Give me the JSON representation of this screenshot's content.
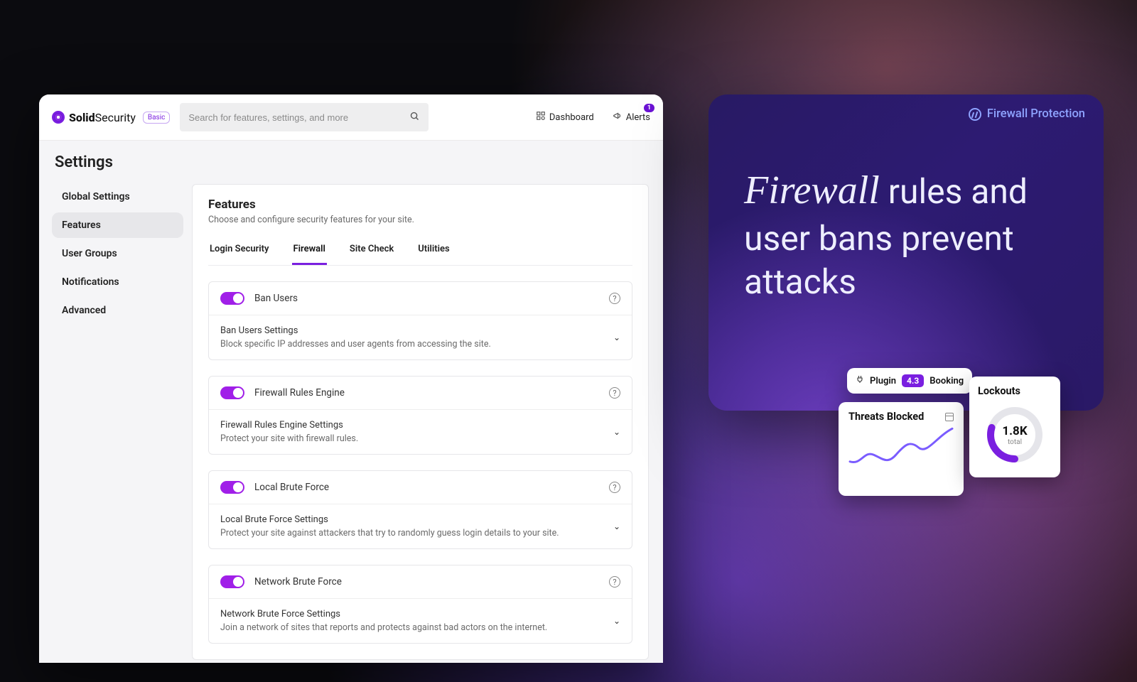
{
  "brand": {
    "bold": "Solid",
    "light": "Security",
    "badge": "Basic"
  },
  "search": {
    "placeholder": "Search for features, settings, and more"
  },
  "toplinks": {
    "dashboard": "Dashboard",
    "alerts": "Alerts",
    "alerts_badge": "1"
  },
  "page_title": "Settings",
  "sidebar": {
    "items": [
      {
        "label": "Global Settings"
      },
      {
        "label": "Features"
      },
      {
        "label": "User Groups"
      },
      {
        "label": "Notifications"
      },
      {
        "label": "Advanced"
      }
    ],
    "active_index": 1
  },
  "panel": {
    "heading": "Features",
    "sub": "Choose and configure security features for your site.",
    "tabs": [
      {
        "label": "Login Security"
      },
      {
        "label": "Firewall"
      },
      {
        "label": "Site Check"
      },
      {
        "label": "Utilities"
      }
    ],
    "active_tab": 1,
    "features": [
      {
        "name": "Ban Users",
        "settings_title": "Ban Users Settings",
        "settings_desc": "Block specific IP addresses and user agents from accessing the site."
      },
      {
        "name": "Firewall Rules Engine",
        "settings_title": "Firewall Rules Engine Settings",
        "settings_desc": "Protect your site with firewall rules."
      },
      {
        "name": "Local Brute Force",
        "settings_title": "Local Brute Force Settings",
        "settings_desc": "Protect your site against attackers that try to randomly guess login details to your site."
      },
      {
        "name": "Network Brute Force",
        "settings_title": "Network Brute Force Settings",
        "settings_desc": "Join a network of sites that reports and protects against bad actors on the internet."
      }
    ]
  },
  "promo": {
    "kicker": "Firewall Protection",
    "title_em": "Firewall",
    "title_rest": " rules and user bans prevent attacks"
  },
  "plugin_chip": {
    "label": "Plugin",
    "score": "4.3",
    "name": "Booking"
  },
  "threats_card": {
    "title": "Threats Blocked"
  },
  "lockouts_card": {
    "title": "Lockouts",
    "value": "1.8K",
    "sub": "total"
  },
  "colors": {
    "accent": "#7a1fe0"
  }
}
